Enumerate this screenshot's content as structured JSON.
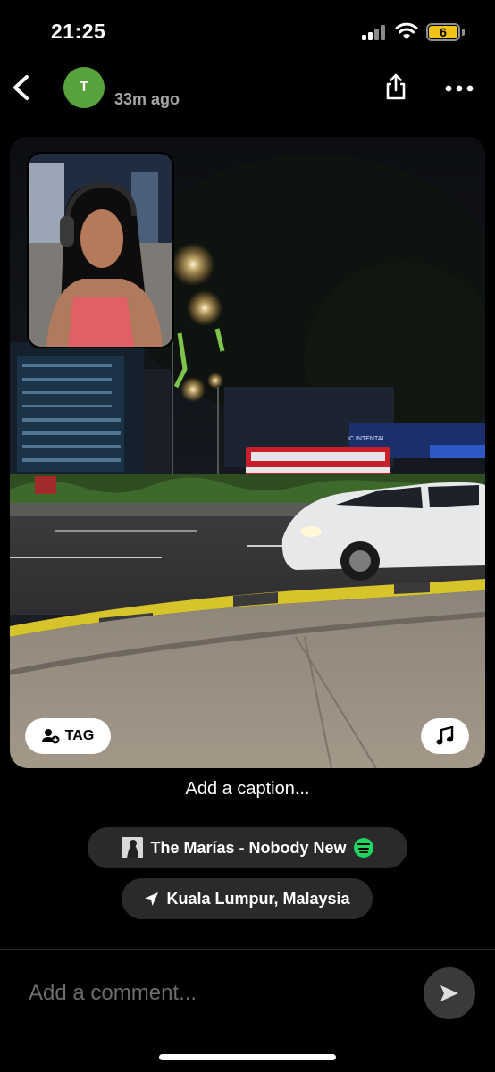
{
  "status_bar": {
    "time": "21:25",
    "battery_level": "6",
    "battery_color": "#f0c419"
  },
  "header": {
    "avatar_initial": "T",
    "avatar_color": "#58a23c",
    "time_ago": "33m ago",
    "icons": [
      "chevron-left-icon",
      "share-icon",
      "more-icon"
    ]
  },
  "photo": {
    "tag_label": "TAG",
    "music_icon": "music-note-icon"
  },
  "caption": {
    "placeholder": "Add a caption..."
  },
  "song": {
    "label": "The Marías - Nobody New",
    "brand_color": "#1ed760"
  },
  "location": {
    "label": "Kuala Lumpur, Malaysia"
  },
  "comment": {
    "placeholder": "Add a comment..."
  }
}
